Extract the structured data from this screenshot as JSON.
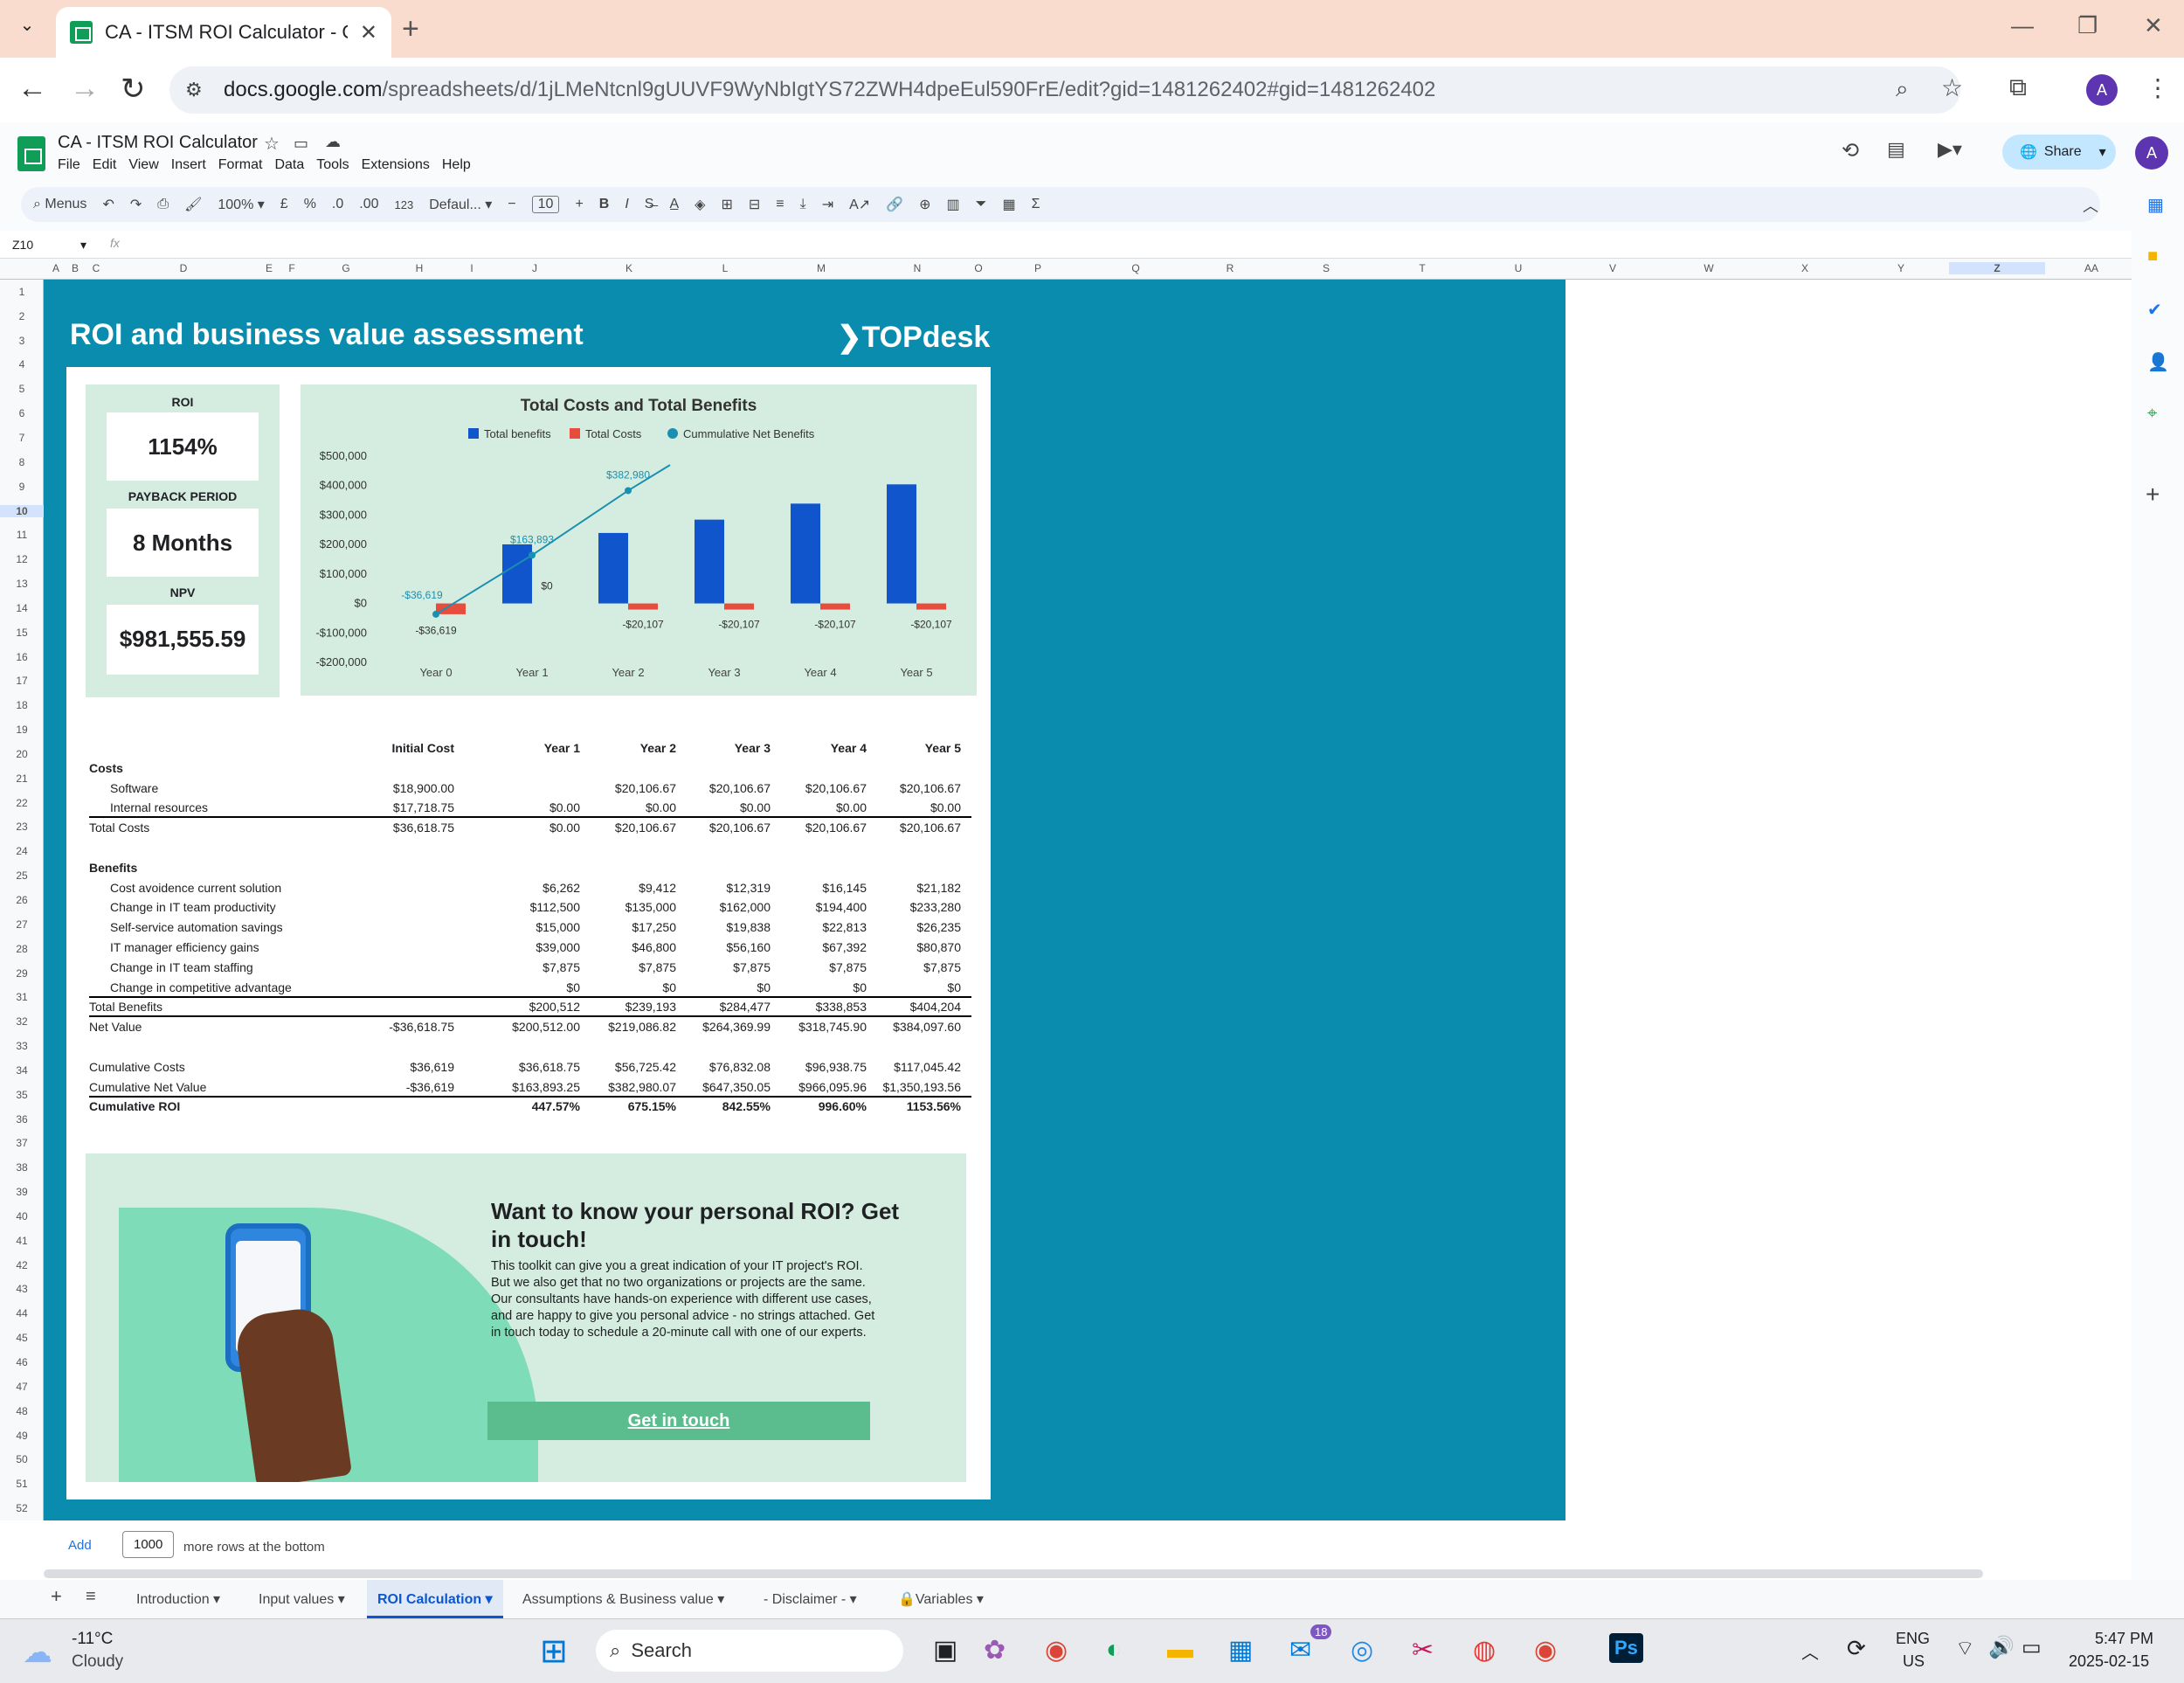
{
  "browser": {
    "tab_title": "CA - ITSM ROI Calculator - Goo",
    "url_domain": "docs.google.com",
    "url_path": "/spreadsheets/d/1jLMeNtcnl9gUUVF9WyNbIgtYS72ZWH4dpeEul590FrE/edit?gid=1481262402#gid=1481262402",
    "avatar": "A"
  },
  "doc": {
    "title": "CA - ITSM ROI Calculator",
    "menus": [
      "File",
      "Edit",
      "View",
      "Insert",
      "Format",
      "Data",
      "Tools",
      "Extensions",
      "Help"
    ],
    "share_label": "Share",
    "avatar": "A"
  },
  "toolbar": {
    "menus_label": "Menus",
    "zoom": "100%",
    "currency": "£",
    "percent": "%",
    "dec_dec": ".0",
    "dec_inc": ".00",
    "format_123": "123",
    "font": "Defaul...",
    "font_size": "10",
    "bold": "B",
    "italic": "I",
    "sum": "Σ"
  },
  "formula_bar": {
    "cell_ref": "Z10",
    "fx": "fx"
  },
  "columns": [
    "A",
    "B",
    "C",
    "D",
    "E",
    "F",
    "G",
    "H",
    "I",
    "J",
    "K",
    "L",
    "M",
    "N",
    "O",
    "P",
    "Q",
    "R",
    "S",
    "T",
    "U",
    "V",
    "W",
    "X",
    "Y",
    "Z",
    "AA"
  ],
  "rows": [
    "1",
    "2",
    "3",
    "4",
    "5",
    "6",
    "7",
    "8",
    "9",
    "10",
    "11",
    "12",
    "13",
    "14",
    "15",
    "16",
    "17",
    "18",
    "19",
    "20",
    "21",
    "22",
    "23",
    "24",
    "25",
    "26",
    "27",
    "28",
    "29",
    "31",
    "32",
    "33",
    "34",
    "35",
    "36",
    "37",
    "38",
    "39",
    "40",
    "41",
    "42",
    "43",
    "44",
    "45",
    "46",
    "47",
    "48",
    "49",
    "50",
    "51",
    "52"
  ],
  "sheet": {
    "banner_title": "ROI and business value assessment",
    "brand": "TOPdesk",
    "kpis": {
      "roi_label": "ROI",
      "roi_value": "1154%",
      "payback_label": "PAYBACK PERIOD",
      "payback_value": "8 Months",
      "npv_label": "NPV",
      "npv_value": "$981,555.59"
    }
  },
  "chart_data": {
    "type": "bar",
    "title": "Total Costs and Total Benefits",
    "categories": [
      "Year 0",
      "Year 1",
      "Year 2",
      "Year 3",
      "Year 4",
      "Year 5"
    ],
    "series": [
      {
        "name": "Total benefits",
        "type": "bar",
        "color": "#1155cc",
        "values": [
          0,
          200512,
          239193,
          284477,
          338853,
          404204
        ]
      },
      {
        "name": "Total Costs",
        "type": "bar",
        "color": "#e74c3c",
        "values": [
          -36619,
          0,
          -20107,
          -20107,
          -20107,
          -20107
        ]
      },
      {
        "name": "Cummulative Net Benefits",
        "type": "line",
        "color": "#1b8fb0",
        "values": [
          -36619,
          163893,
          382980
        ]
      }
    ],
    "data_labels": {
      "costs": [
        "-$36,619",
        "$0",
        "-$20,107",
        "-$20,107",
        "-$20,107",
        "-$20,107"
      ],
      "cumulative": [
        "-$36,619",
        "$163,893",
        "$382,980"
      ]
    },
    "y_ticks": [
      "$500,000",
      "$400,000",
      "$300,000",
      "$200,000",
      "$100,000",
      "$0",
      "-$100,000",
      "-$200,000"
    ],
    "ylim": [
      -200000,
      500000
    ],
    "legend": "top"
  },
  "table": {
    "headers": [
      "Initial Cost",
      "Year 1",
      "Year 2",
      "Year 3",
      "Year 4",
      "Year 5"
    ],
    "costs_label": "Costs",
    "cost_rows": [
      {
        "label": "Software",
        "vals": [
          "$18,900.00",
          "",
          "$20,106.67",
          "$20,106.67",
          "$20,106.67",
          "$20,106.67"
        ]
      },
      {
        "label": "Internal resources",
        "vals": [
          "$17,718.75",
          "$0.00",
          "$0.00",
          "$0.00",
          "$0.00",
          "$0.00"
        ]
      }
    ],
    "total_costs": {
      "label": "Total Costs",
      "vals": [
        "$36,618.75",
        "$0.00",
        "$20,106.67",
        "$20,106.67",
        "$20,106.67",
        "$20,106.67"
      ]
    },
    "benefits_label": "Benefits",
    "benefit_rows": [
      {
        "label": "Cost avoidence current solution",
        "vals": [
          "",
          "$6,262",
          "$9,412",
          "$12,319",
          "$16,145",
          "$21,182"
        ]
      },
      {
        "label": "Change in IT team productivity",
        "vals": [
          "",
          "$112,500",
          "$135,000",
          "$162,000",
          "$194,400",
          "$233,280"
        ]
      },
      {
        "label": "Self-service automation savings",
        "vals": [
          "",
          "$15,000",
          "$17,250",
          "$19,838",
          "$22,813",
          "$26,235"
        ]
      },
      {
        "label": "IT manager efficiency gains",
        "vals": [
          "",
          "$39,000",
          "$46,800",
          "$56,160",
          "$67,392",
          "$80,870"
        ]
      },
      {
        "label": "Change in IT team staffing",
        "vals": [
          "",
          "$7,875",
          "$7,875",
          "$7,875",
          "$7,875",
          "$7,875"
        ]
      },
      {
        "label": "Change in competitive advantage",
        "vals": [
          "",
          "$0",
          "$0",
          "$0",
          "$0",
          "$0"
        ]
      }
    ],
    "total_benefits": {
      "label": "Total Benefits",
      "vals": [
        "",
        "$200,512",
        "$239,193",
        "$284,477",
        "$338,853",
        "$404,204"
      ]
    },
    "net_value": {
      "label": "Net Value",
      "vals": [
        "-$36,618.75",
        "$200,512.00",
        "$219,086.82",
        "$264,369.99",
        "$318,745.90",
        "$384,097.60"
      ]
    },
    "cumulative_costs": {
      "label": "Cumulative Costs",
      "vals": [
        "$36,619",
        "$36,618.75",
        "$56,725.42",
        "$76,832.08",
        "$96,938.75",
        "$117,045.42"
      ]
    },
    "cumulative_net": {
      "label": "Cumulative Net Value",
      "vals": [
        "-$36,619",
        "$163,893.25",
        "$382,980.07",
        "$647,350.05",
        "$966,095.96",
        "$1,350,193.56"
      ]
    },
    "cumulative_roi": {
      "label": "Cumulative ROI",
      "vals": [
        "",
        "447.57%",
        "675.15%",
        "842.55%",
        "996.60%",
        "1153.56%"
      ]
    }
  },
  "cta": {
    "heading": "Want to know your personal ROI? Get in touch!",
    "body": "This toolkit can give you a great indication of your IT project's ROI. But we also get that no two organizations or projects are the same. Our consultants have hands-on experience with different use cases, and are happy to give you personal advice - no strings attached. Get in touch today to schedule a 20-minute call with one of our experts.",
    "button": "Get in touch"
  },
  "add_rows": {
    "add": "Add",
    "count": "1000",
    "suffix": "more rows at the bottom"
  },
  "sheet_tabs": [
    "Introduction",
    "Input values",
    "ROI Calculation",
    "Assumptions & Business value",
    "- Disclaimer -",
    "Variables"
  ],
  "active_tab": "ROI Calculation",
  "taskbar": {
    "temp": "-11°C",
    "weather": "Cloudy",
    "search": "Search",
    "lang1": "ENG",
    "lang2": "US",
    "time": "5:47 PM",
    "date": "2025-02-15",
    "badge": "18"
  }
}
